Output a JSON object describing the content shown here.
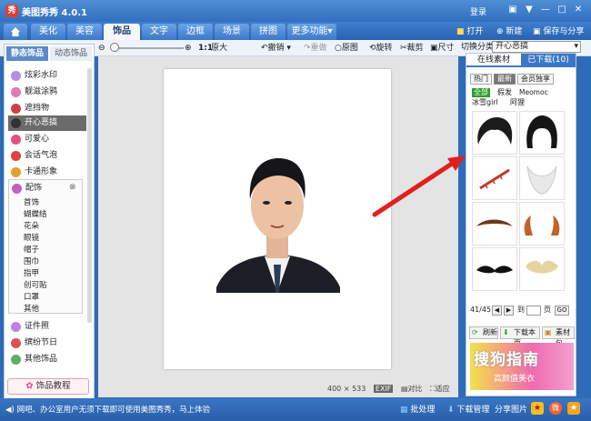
{
  "app": {
    "logo": "秀",
    "title": "美图秀秀 4.0.1",
    "login": "登录"
  },
  "window_controls": {
    "icons": [
      "chat-icon",
      "menu-icon",
      "minimize-icon",
      "restore-icon",
      "close-icon"
    ],
    "glyphs": [
      "▣",
      "▼",
      "—",
      "□",
      "✕"
    ]
  },
  "tabs": [
    {
      "label": "美化"
    },
    {
      "label": "美容"
    },
    {
      "label": "饰品"
    },
    {
      "label": "文字"
    },
    {
      "label": "边框"
    },
    {
      "label": "场景"
    },
    {
      "label": "拼图"
    },
    {
      "label": "更多功能▾"
    }
  ],
  "top_actions": {
    "open": "打开",
    "new": "新建",
    "save": "保存与分享"
  },
  "toolbar": {
    "zoom_level": "1:1",
    "original_size": "原大",
    "undo": "撤销",
    "redo": "重做",
    "original": "原图",
    "rotate": "旋转",
    "crop": "裁剪",
    "resize": "尺寸"
  },
  "left_panel": {
    "tabs": [
      "静态饰品",
      "动态饰品"
    ],
    "categories": [
      {
        "label": "炫彩水印",
        "color": "#b48ee0"
      },
      {
        "label": "靓滋涂鸦",
        "color": "#e07ab4"
      },
      {
        "label": "遮挡物",
        "color": "#d04040"
      },
      {
        "label": "开心恶搞",
        "color": "#555555"
      },
      {
        "label": "可爱心",
        "color": "#e05080"
      },
      {
        "label": "会话气泡",
        "color": "#e04040"
      },
      {
        "label": "卡通形象",
        "color": "#e0a030"
      },
      {
        "label": "配饰",
        "color": "#c060c0"
      }
    ],
    "sub_items": [
      "首饰",
      "蝴蝶结",
      "花朵",
      "眼镜",
      "帽子",
      "围巾",
      "指甲",
      "创可贴",
      "口罩",
      "其他"
    ],
    "bottom_categories": [
      {
        "label": "证件照",
        "color": "#c080e0"
      },
      {
        "label": "缤纷节日",
        "color": "#e05050"
      },
      {
        "label": "其他饰品",
        "color": "#60b060"
      }
    ],
    "tutorial": "饰品教程"
  },
  "image_info": {
    "width": "400",
    "height": "533",
    "tag": "EXIF",
    "compare": "对比",
    "fit": "适应"
  },
  "right_panel": {
    "category_label": "切换分类",
    "category_value": "开心恶搞",
    "tabs": [
      "在线素材",
      "已下载(10)"
    ],
    "filters": [
      "热门",
      "最新",
      "会员独享"
    ],
    "tags": [
      "全部",
      "假发",
      "Meomoc",
      "冰雪girl",
      "阿狸"
    ],
    "pagination": {
      "current": "41/45",
      "goto": "到",
      "page": "页",
      "go": "GO"
    },
    "buttons": {
      "refresh": "刷新",
      "download_page": "下载本页",
      "library": "素材包"
    },
    "ad": {
      "line1": "搜狗指南",
      "line2": "高颜值美衣"
    }
  },
  "status": {
    "message": "网吧、办公室用户无须下载即可使用美图秀秀，马上体验",
    "batch": "批处理",
    "downloads": "下载管理",
    "share": "分享图片"
  },
  "colors": {
    "brand_blue": "#2e6bb8",
    "accent_green": "#2c9c2c",
    "arrow_red": "#e02020"
  }
}
